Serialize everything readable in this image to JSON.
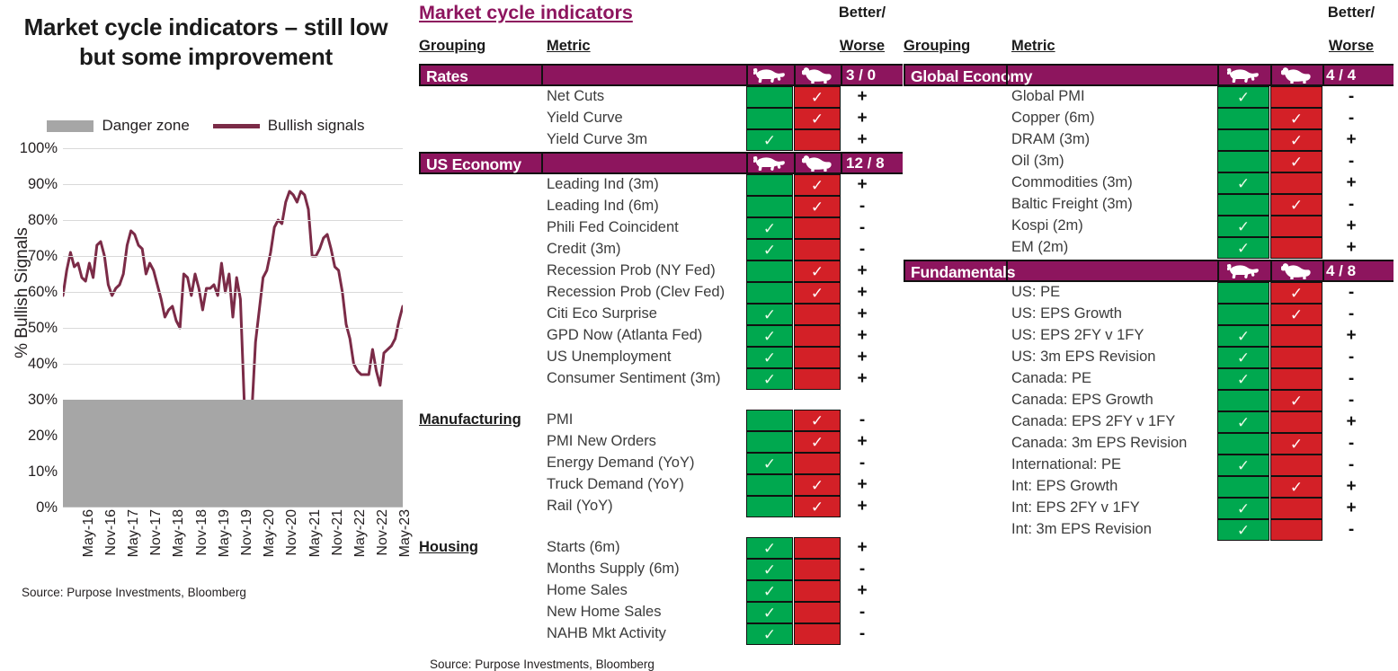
{
  "chart": {
    "title": "Market cycle indicators – still low but some improvement",
    "legend": [
      {
        "label": "Danger zone",
        "kind": "box",
        "color": "#a6a6a6"
      },
      {
        "label": "Bullish signals",
        "kind": "line",
        "color": "#7b2b47"
      }
    ],
    "source": "Source: Purpose Investments, Bloomberg"
  },
  "chart_data": {
    "type": "line",
    "title": "Market cycle indicators – still low but some improvement",
    "xlabel": "",
    "ylabel": "% Bullish Signals",
    "ylim": [
      0,
      100
    ],
    "ytick_labels": [
      "0%",
      "10%",
      "20%",
      "30%",
      "40%",
      "50%",
      "60%",
      "70%",
      "80%",
      "90%",
      "100%"
    ],
    "yticks": [
      0,
      10,
      20,
      30,
      40,
      50,
      60,
      70,
      80,
      90,
      100
    ],
    "grid": true,
    "legend_position": "above-plot",
    "bands": [
      {
        "name": "Danger zone",
        "from": 0,
        "to": 30,
        "color": "#a6a6a6"
      }
    ],
    "x": [
      "May-16",
      "Nov-16",
      "May-17",
      "Nov-17",
      "May-18",
      "Nov-18",
      "May-19",
      "Nov-19",
      "May-20",
      "Nov-20",
      "May-21",
      "Nov-21",
      "May-22",
      "Nov-22",
      "May-23"
    ],
    "xtick_labels": [
      "May-16",
      "Nov-16",
      "May-17",
      "Nov-17",
      "May-18",
      "Nov-18",
      "May-19",
      "Nov-19",
      "May-20",
      "Nov-20",
      "May-21",
      "Nov-21",
      "May-22",
      "Nov-22",
      "May-23"
    ],
    "series": [
      {
        "name": "Bullish signals",
        "color": "#7b2b47",
        "values": [
          59,
          66,
          71,
          67,
          68,
          64,
          63,
          68,
          64,
          73,
          74,
          70,
          62,
          59,
          61,
          62,
          65,
          73,
          77,
          76,
          73,
          72,
          65,
          68,
          66,
          62,
          58,
          53,
          55,
          56,
          52,
          50,
          65,
          64,
          59,
          65,
          61,
          55,
          61,
          61,
          62,
          59,
          68,
          60,
          65,
          53,
          64,
          58,
          30,
          21,
          26,
          46,
          55,
          64,
          66,
          71,
          78,
          80,
          79,
          85,
          88,
          87,
          85,
          88,
          87,
          83,
          70,
          70,
          72,
          75,
          76,
          72,
          67,
          66,
          60,
          51,
          47,
          40,
          38,
          37,
          37,
          37,
          44,
          38,
          34,
          43,
          44,
          45,
          47,
          52,
          56
        ]
      }
    ]
  },
  "tables": [
    {
      "id": "left",
      "title": "Market cycle indicators",
      "headers": {
        "grouping": "Grouping",
        "metric": "Metric",
        "better": "Better/",
        "worse": "Worse"
      },
      "source": "Source: Purpose Investments, Bloomberg",
      "sections": [
        {
          "name": "Rates",
          "style": "bar",
          "score": "3 / 0",
          "rows": [
            {
              "metric": "Net Cuts",
              "bull": false,
              "bear": true,
              "change": "+"
            },
            {
              "metric": "Yield Curve",
              "bull": false,
              "bear": true,
              "change": "+"
            },
            {
              "metric": "Yield Curve 3m",
              "bull": true,
              "bear": false,
              "change": "+"
            }
          ]
        },
        {
          "name": "US Economy",
          "style": "bar",
          "score": "12 / 8",
          "rows": [
            {
              "metric": "Leading Ind (3m)",
              "bull": false,
              "bear": true,
              "change": "+"
            },
            {
              "metric": "Leading Ind (6m)",
              "bull": false,
              "bear": true,
              "change": "-"
            },
            {
              "metric": "Phili Fed Coincident",
              "bull": true,
              "bear": false,
              "change": "-"
            },
            {
              "metric": "Credit (3m)",
              "bull": true,
              "bear": false,
              "change": "-"
            },
            {
              "metric": "Recession Prob (NY Fed)",
              "bull": false,
              "bear": true,
              "change": "+"
            },
            {
              "metric": "Recession Prob (Clev Fed)",
              "bull": false,
              "bear": true,
              "change": "+"
            },
            {
              "metric": "Citi Eco Surprise",
              "bull": true,
              "bear": false,
              "change": "+"
            },
            {
              "metric": "GPD Now (Atlanta Fed)",
              "bull": true,
              "bear": false,
              "change": "+"
            },
            {
              "metric": "US Unemployment",
              "bull": true,
              "bear": false,
              "change": "+"
            },
            {
              "metric": "Consumer Sentiment (3m)",
              "bull": true,
              "bear": false,
              "change": "+"
            }
          ]
        },
        {
          "name": "Manufacturing",
          "style": "plain",
          "score": "",
          "rows": [
            {
              "metric": "PMI",
              "bull": false,
              "bear": true,
              "change": "-"
            },
            {
              "metric": "PMI New Orders",
              "bull": false,
              "bear": true,
              "change": "+"
            },
            {
              "metric": "Energy Demand (YoY)",
              "bull": true,
              "bear": false,
              "change": "-"
            },
            {
              "metric": "Truck Demand (YoY)",
              "bull": false,
              "bear": true,
              "change": "+"
            },
            {
              "metric": "Rail (YoY)",
              "bull": false,
              "bear": true,
              "change": "+"
            }
          ]
        },
        {
          "name": "Housing",
          "style": "plain",
          "score": "",
          "rows": [
            {
              "metric": "Starts (6m)",
              "bull": true,
              "bear": false,
              "change": "+"
            },
            {
              "metric": "Months Supply (6m)",
              "bull": true,
              "bear": false,
              "change": "-"
            },
            {
              "metric": "Home Sales",
              "bull": true,
              "bear": false,
              "change": "+"
            },
            {
              "metric": "New Home Sales",
              "bull": true,
              "bear": false,
              "change": "-"
            },
            {
              "metric": "NAHB Mkt Activity",
              "bull": true,
              "bear": false,
              "change": "-"
            }
          ]
        }
      ]
    },
    {
      "id": "right",
      "title": "",
      "headers": {
        "grouping": "Grouping",
        "metric": "Metric",
        "better": "Better/",
        "worse": "Worse"
      },
      "source": "",
      "sections": [
        {
          "name": "Global Economy",
          "style": "bar",
          "score": "4 / 4",
          "rows": [
            {
              "metric": "Global PMI",
              "bull": true,
              "bear": false,
              "change": "-"
            },
            {
              "metric": "Copper (6m)",
              "bull": false,
              "bear": true,
              "change": "-"
            },
            {
              "metric": "DRAM (3m)",
              "bull": false,
              "bear": true,
              "change": "+"
            },
            {
              "metric": "Oil (3m)",
              "bull": false,
              "bear": true,
              "change": "-"
            },
            {
              "metric": "Commodities (3m)",
              "bull": true,
              "bear": false,
              "change": "+"
            },
            {
              "metric": "Baltic Freight (3m)",
              "bull": false,
              "bear": true,
              "change": "-"
            },
            {
              "metric": "Kospi (2m)",
              "bull": true,
              "bear": false,
              "change": "+"
            },
            {
              "metric": "EM (2m)",
              "bull": true,
              "bear": false,
              "change": "+"
            }
          ]
        },
        {
          "name": "Fundamentals",
          "style": "bar",
          "score": "4 / 8",
          "rows": [
            {
              "metric": "US: PE",
              "bull": false,
              "bear": true,
              "change": "-"
            },
            {
              "metric": "US: EPS Growth",
              "bull": false,
              "bear": true,
              "change": "-"
            },
            {
              "metric": "US: EPS 2FY v 1FY",
              "bull": true,
              "bear": false,
              "change": "+"
            },
            {
              "metric": "US: 3m EPS Revision",
              "bull": true,
              "bear": false,
              "change": "-"
            },
            {
              "metric": "Canada: PE",
              "bull": true,
              "bear": false,
              "change": "-"
            },
            {
              "metric": "Canada: EPS Growth",
              "bull": false,
              "bear": true,
              "change": "-"
            },
            {
              "metric": "Canada: EPS 2FY v 1FY",
              "bull": true,
              "bear": false,
              "change": "+"
            },
            {
              "metric": "Canada: 3m EPS Revision",
              "bull": false,
              "bear": true,
              "change": "-"
            },
            {
              "metric": "International: PE",
              "bull": true,
              "bear": false,
              "change": "-"
            },
            {
              "metric": "Int: EPS Growth",
              "bull": false,
              "bear": true,
              "change": "+"
            },
            {
              "metric": "Int: EPS 2FY v 1FY",
              "bull": true,
              "bear": false,
              "change": "+"
            },
            {
              "metric": "Int: 3m EPS Revision",
              "bull": true,
              "bear": false,
              "change": "-"
            }
          ]
        }
      ]
    }
  ],
  "icons": {
    "bull": "bull-icon",
    "bear": "bear-icon",
    "check": "✓"
  },
  "colors": {
    "purple": "#8d155e",
    "green": "#00a84f",
    "red": "#d32027",
    "line": "#7b2b47",
    "danger": "#a6a6a6"
  }
}
